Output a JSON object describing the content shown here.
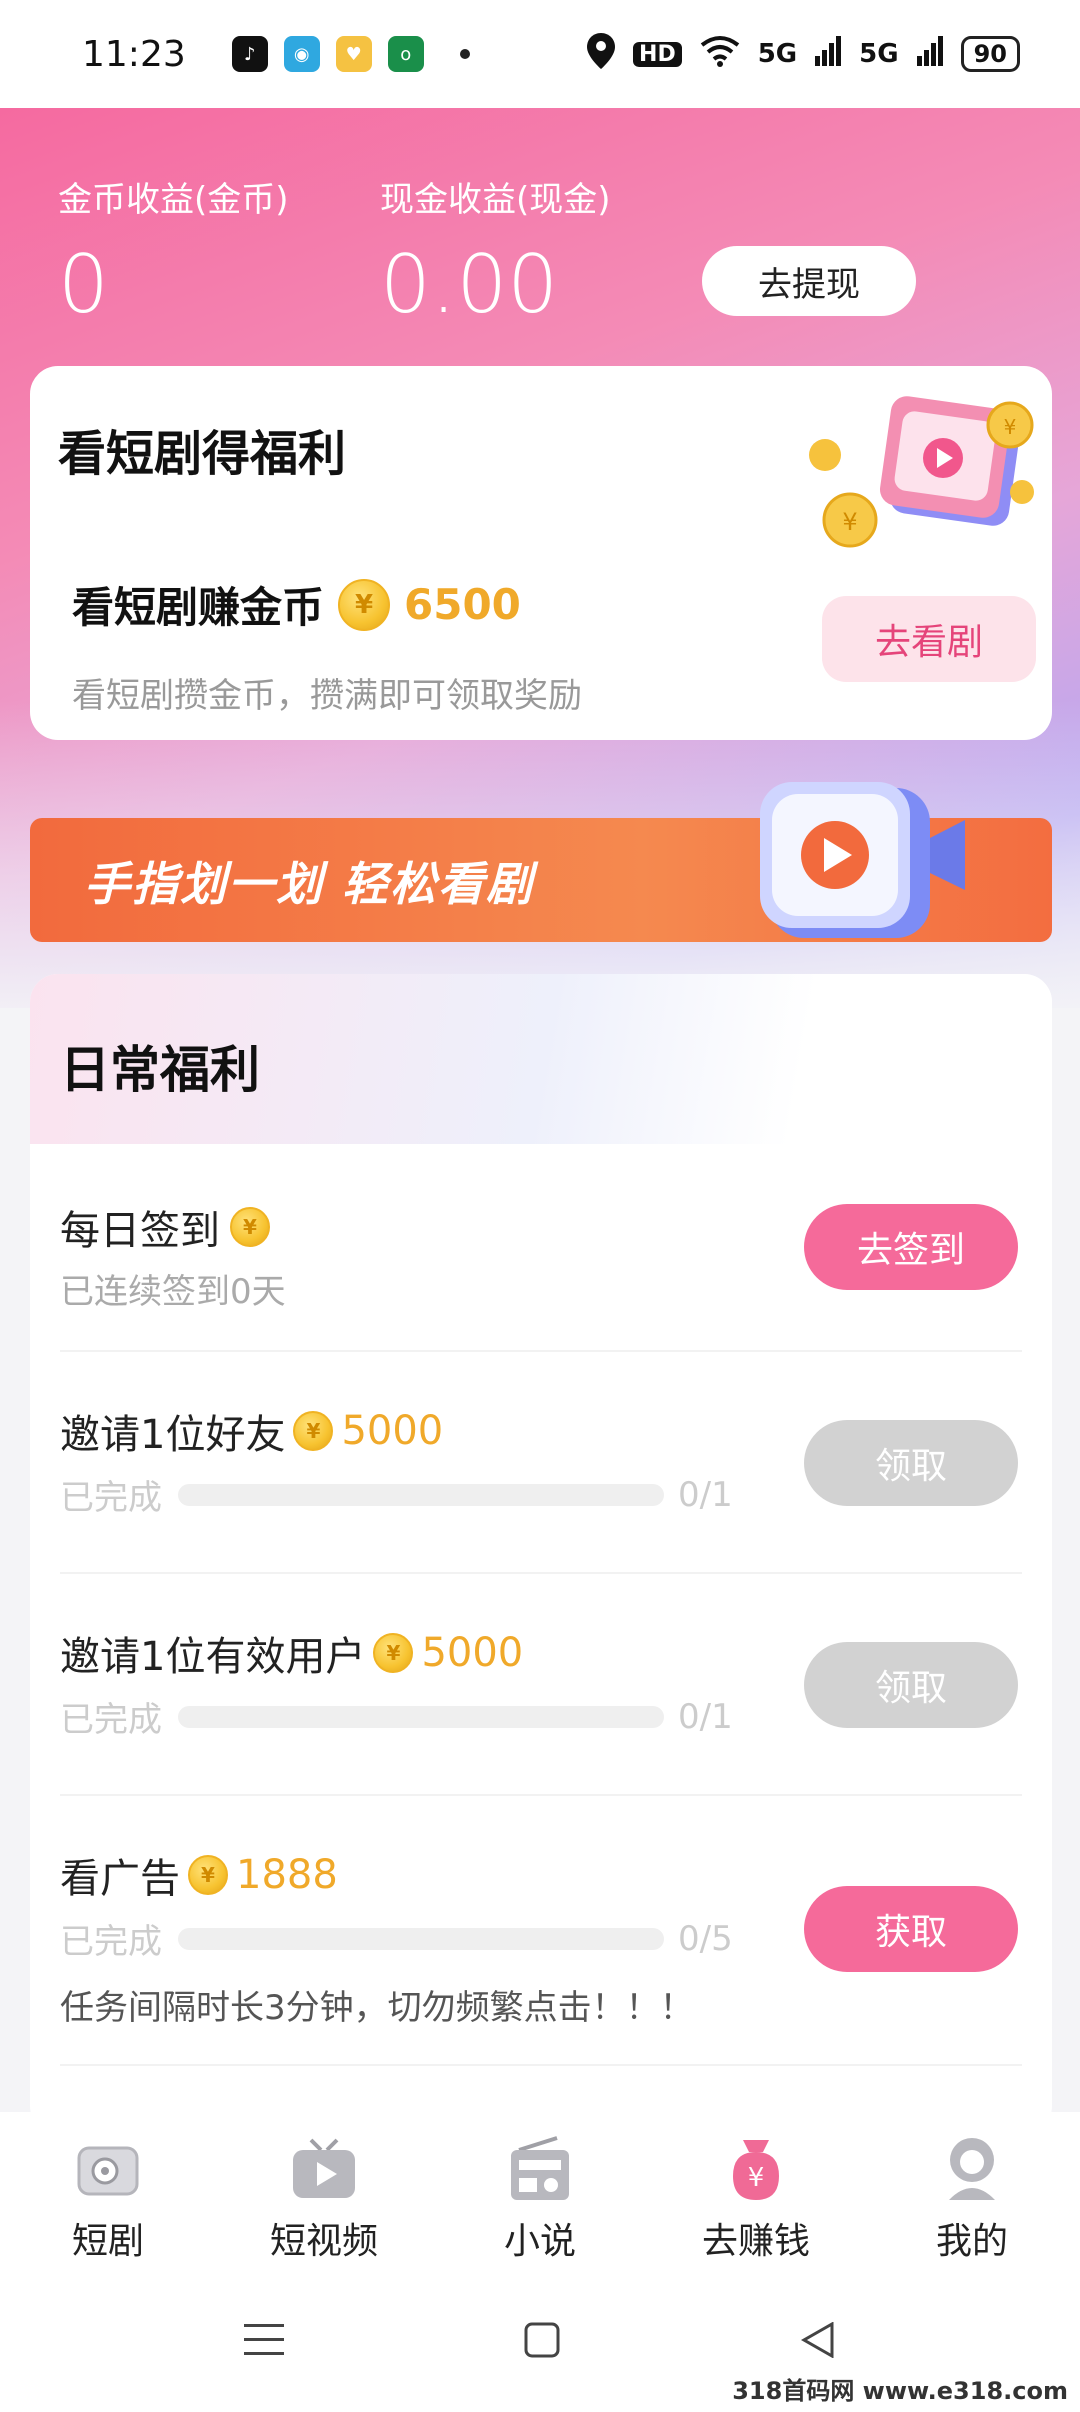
{
  "status_bar": {
    "time": "11:23",
    "battery": "90",
    "network": "HD",
    "signal1": "5G",
    "signal2": "5G"
  },
  "earnings": {
    "coin_label": "金币收益(金币)",
    "coin_value": "0",
    "cash_label": "现金收益(现金)",
    "cash_value": "0.00",
    "withdraw_button": "去提现"
  },
  "drama_card": {
    "title": "看短剧得福利",
    "subtitle": "看短剧赚金币",
    "coin_amount": "6500",
    "description": "看短剧攒金币，攒满即可领取奖励",
    "watch_button": "去看剧"
  },
  "banner": {
    "text": "手指划一划 轻松看剧"
  },
  "daily": {
    "title": "日常福利",
    "tasks": [
      {
        "title": "每日签到",
        "sub": "已连续签到0天",
        "button": "去签到"
      },
      {
        "title": "邀请1位好友",
        "coin": "5000",
        "status": "已完成",
        "progress": "0/1",
        "progress_fraction": 0,
        "button": "领取"
      },
      {
        "title": "邀请1位有效用户",
        "coin": "5000",
        "status": "已完成",
        "progress": "0/1",
        "progress_fraction": 0,
        "button": "领取"
      },
      {
        "title": "看广告",
        "coin": "1888",
        "status": "已完成",
        "progress": "0/5",
        "progress_fraction": 0,
        "note": "任务间隔时长3分钟，切勿频繁点击！！！",
        "button": "获取"
      }
    ]
  },
  "tabbar": {
    "items": [
      {
        "label": "短剧",
        "icon": "drama-icon"
      },
      {
        "label": "短视频",
        "icon": "tv-icon"
      },
      {
        "label": "小说",
        "icon": "radio-icon"
      },
      {
        "label": "去赚钱",
        "icon": "money-bag-icon"
      },
      {
        "label": "我的",
        "icon": "profile-icon"
      }
    ]
  },
  "watermark": "318首码网 www.e318.com",
  "colors": {
    "accent_pink": "#f56a9a",
    "coin_gold": "#f0a92a",
    "disabled_gray": "#d2d2d2"
  }
}
